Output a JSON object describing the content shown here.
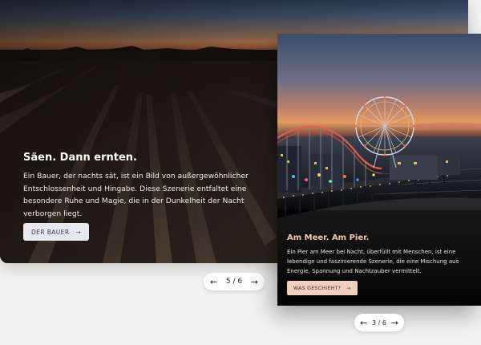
{
  "slide_back": {
    "title": "Säen. Dann ernten.",
    "text": "Ein Bauer, der nachts sät, ist ein Bild von außergewöhnlicher Entschlossenheit und Hingabe. Diese Szenerie entfaltet eine besondere Ruhe und Magie, die in der Dunkelheit der Nacht verborgen liegt.",
    "button_label": "DER BAUER",
    "button_icon": "arrow-right-icon",
    "pager": {
      "prev_icon": "arrow-left-icon",
      "label": "5 / 6",
      "next_icon": "arrow-right-icon"
    }
  },
  "slide_front": {
    "title": "Am Meer. Am Pier.",
    "text": "Ein Pier am Meer bei Nacht, überfüllt mit Menschen, ist eine lebendige und faszinierende Szenerie, die eine Mischung aus Energie, Spannung und Nachtzauber vermittelt.",
    "button_label": "WAS GESCHIEHT?",
    "button_icon": "arrow-right-icon",
    "pager": {
      "prev_icon": "arrow-left-icon",
      "label": "3 / 6",
      "next_icon": "arrow-right-icon"
    }
  },
  "colors": {
    "page_background": "#f2f2f2",
    "back_button_bg": "#e6e9ef",
    "front_title": "#f0c8b4",
    "front_button_bg": "#f3cfc0"
  }
}
